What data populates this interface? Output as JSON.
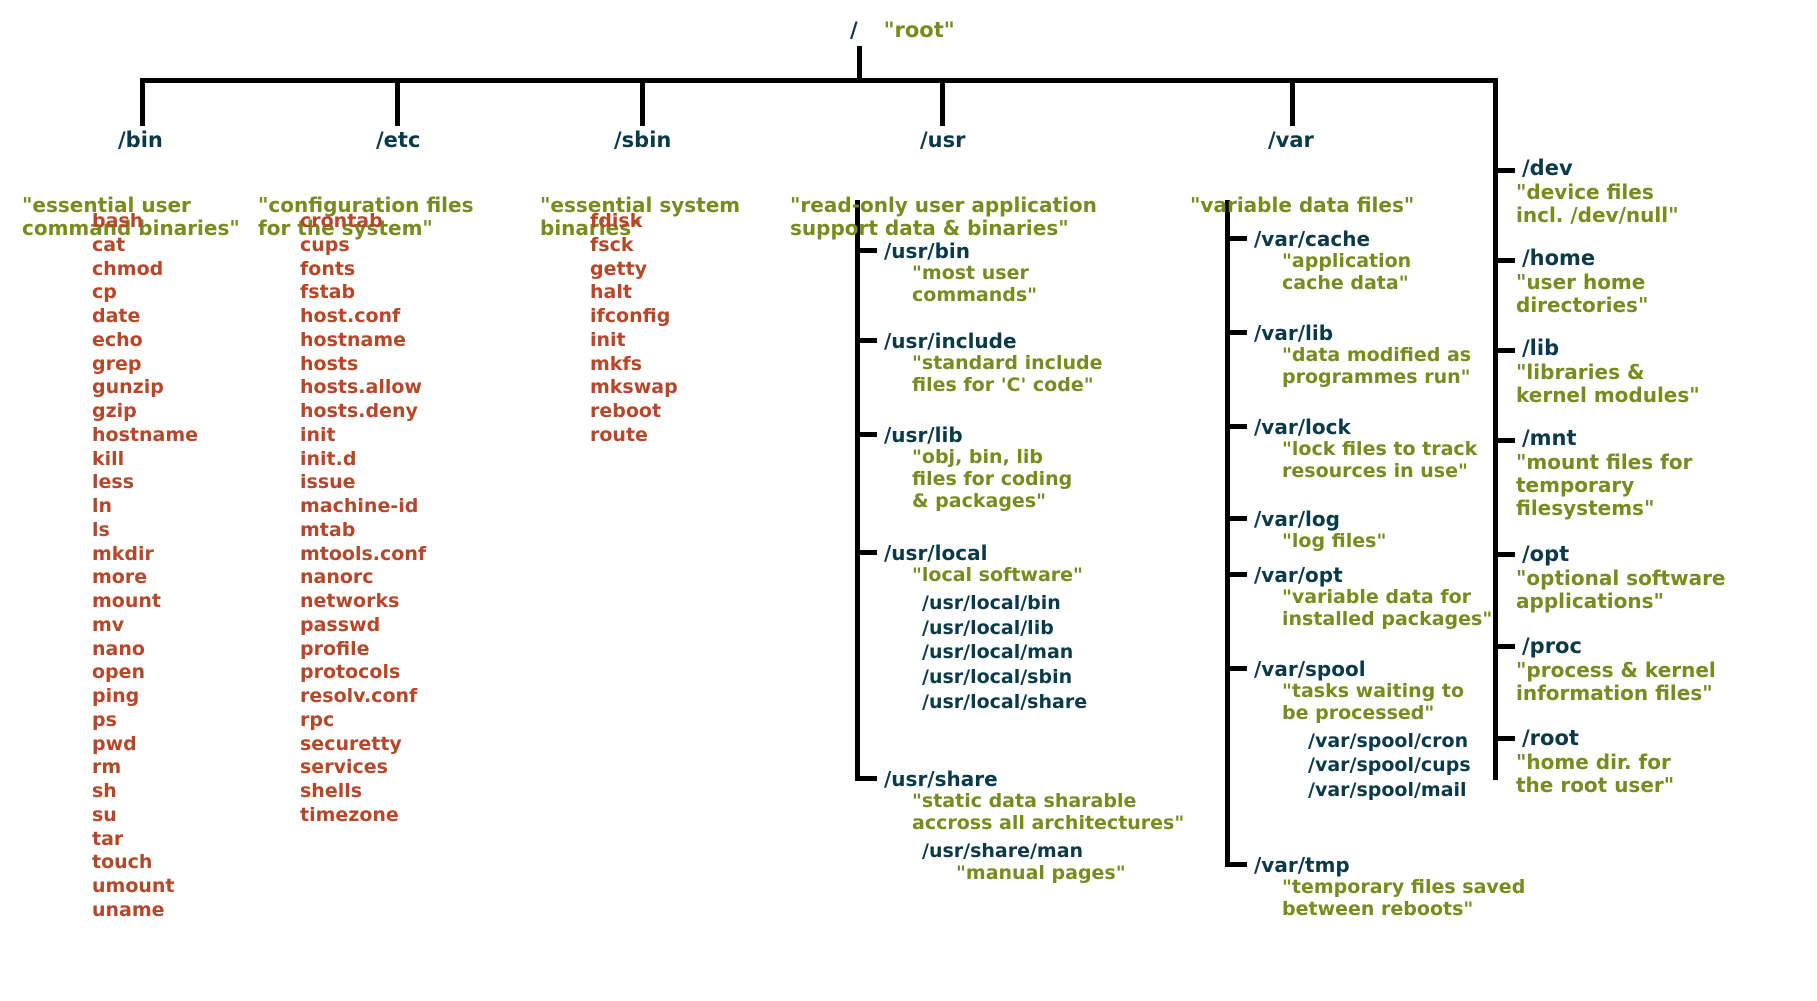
{
  "root": {
    "slash": "/",
    "label": "\"root\""
  },
  "bin": {
    "name": "/bin",
    "desc": "\"essential user\ncommand binaries\"",
    "files": [
      "bash",
      "cat",
      "chmod",
      "cp",
      "date",
      "echo",
      "grep",
      "gunzip",
      "gzip",
      "hostname",
      "kill",
      "less",
      "ln",
      "ls",
      "mkdir",
      "more",
      "mount",
      "mv",
      "nano",
      "open",
      "ping",
      "ps",
      "pwd",
      "rm",
      "sh",
      "su",
      "tar",
      "touch",
      "umount",
      "uname"
    ]
  },
  "etc": {
    "name": "/etc",
    "desc": "\"configuration files\nfor the system\"",
    "files": [
      "crontab",
      "cups",
      "fonts",
      "fstab",
      "host.conf",
      "hostname",
      "hosts",
      "hosts.allow",
      "hosts.deny",
      "init",
      "init.d",
      "issue",
      "machine-id",
      "mtab",
      "mtools.conf",
      "nanorc",
      "networks",
      "passwd",
      "profile",
      "protocols",
      "resolv.conf",
      "rpc",
      "securetty",
      "services",
      "shells",
      "timezone"
    ]
  },
  "sbin": {
    "name": "/sbin",
    "desc": "\"essential system\nbinaries\"",
    "files": [
      "fdisk",
      "fsck",
      "getty",
      "halt",
      "ifconfig",
      "init",
      "mkfs",
      "mkswap",
      "reboot",
      "route"
    ]
  },
  "usr": {
    "name": "/usr",
    "desc": "\"read-only user application\nsupport data & binaries\"",
    "children": [
      {
        "name": "/usr/bin",
        "desc": "\"most user\ncommands\""
      },
      {
        "name": "/usr/include",
        "desc": "\"standard include\nfiles for 'C' code\""
      },
      {
        "name": "/usr/lib",
        "desc": "\"obj, bin, lib\nfiles for coding\n& packages\""
      },
      {
        "name": "/usr/local",
        "desc": "\"local software\"",
        "children": [
          "/usr/local/bin",
          "/usr/local/lib",
          "/usr/local/man",
          "/usr/local/sbin",
          "/usr/local/share"
        ]
      },
      {
        "name": "/usr/share",
        "desc": "\"static data sharable\naccross all architectures\"",
        "children_named": [
          {
            "name": "/usr/share/man",
            "desc": "\"manual pages\""
          }
        ]
      }
    ]
  },
  "var": {
    "name": "/var",
    "desc": "\"variable data files\"",
    "children": [
      {
        "name": "/var/cache",
        "desc": "\"application\ncache data\""
      },
      {
        "name": "/var/lib",
        "desc": "\"data modified as\nprogrammes run\""
      },
      {
        "name": "/var/lock",
        "desc": "\"lock files to track\nresources in use\""
      },
      {
        "name": "/var/log",
        "desc": "\"log files\""
      },
      {
        "name": "/var/opt",
        "desc": "\"variable data for\ninstalled packages\""
      },
      {
        "name": "/var/spool",
        "desc": "\"tasks waiting to\nbe processed\"",
        "children": [
          "/var/spool/cron",
          "/var/spool/cups",
          "/var/spool/mail"
        ]
      },
      {
        "name": "/var/tmp",
        "desc": "\"temporary files saved\nbetween reboots\""
      }
    ]
  },
  "right": [
    {
      "name": "/dev",
      "desc": "\"device files\nincl. /dev/null\""
    },
    {
      "name": "/home",
      "desc": "\"user home\ndirectories\""
    },
    {
      "name": "/lib",
      "desc": "\"libraries &\nkernel modules\""
    },
    {
      "name": "/mnt",
      "desc": "\"mount files for\ntemporary\nfilesystems\""
    },
    {
      "name": "/opt",
      "desc": "\"optional software\napplications\""
    },
    {
      "name": "/proc",
      "desc": "\"process & kernel\ninformation files\""
    },
    {
      "name": "/root",
      "desc": "\"home dir. for\nthe root user\""
    }
  ]
}
